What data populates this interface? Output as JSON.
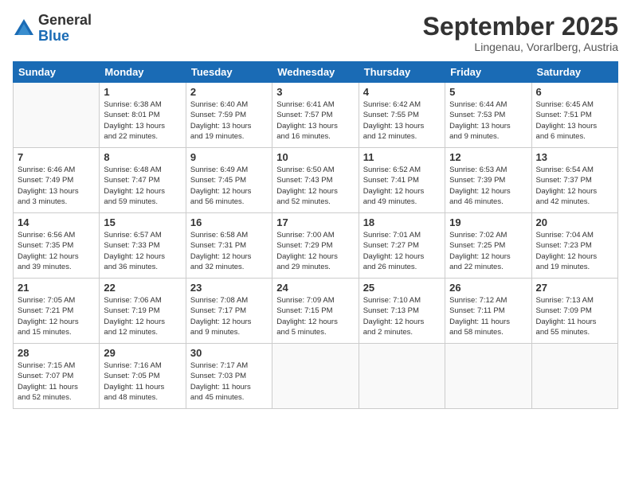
{
  "logo": {
    "general": "General",
    "blue": "Blue"
  },
  "header": {
    "month": "September 2025",
    "location": "Lingenau, Vorarlberg, Austria"
  },
  "weekdays": [
    "Sunday",
    "Monday",
    "Tuesday",
    "Wednesday",
    "Thursday",
    "Friday",
    "Saturday"
  ],
  "weeks": [
    [
      {
        "day": "",
        "info": ""
      },
      {
        "day": "1",
        "info": "Sunrise: 6:38 AM\nSunset: 8:01 PM\nDaylight: 13 hours\nand 22 minutes."
      },
      {
        "day": "2",
        "info": "Sunrise: 6:40 AM\nSunset: 7:59 PM\nDaylight: 13 hours\nand 19 minutes."
      },
      {
        "day": "3",
        "info": "Sunrise: 6:41 AM\nSunset: 7:57 PM\nDaylight: 13 hours\nand 16 minutes."
      },
      {
        "day": "4",
        "info": "Sunrise: 6:42 AM\nSunset: 7:55 PM\nDaylight: 13 hours\nand 12 minutes."
      },
      {
        "day": "5",
        "info": "Sunrise: 6:44 AM\nSunset: 7:53 PM\nDaylight: 13 hours\nand 9 minutes."
      },
      {
        "day": "6",
        "info": "Sunrise: 6:45 AM\nSunset: 7:51 PM\nDaylight: 13 hours\nand 6 minutes."
      }
    ],
    [
      {
        "day": "7",
        "info": "Sunrise: 6:46 AM\nSunset: 7:49 PM\nDaylight: 13 hours\nand 3 minutes."
      },
      {
        "day": "8",
        "info": "Sunrise: 6:48 AM\nSunset: 7:47 PM\nDaylight: 12 hours\nand 59 minutes."
      },
      {
        "day": "9",
        "info": "Sunrise: 6:49 AM\nSunset: 7:45 PM\nDaylight: 12 hours\nand 56 minutes."
      },
      {
        "day": "10",
        "info": "Sunrise: 6:50 AM\nSunset: 7:43 PM\nDaylight: 12 hours\nand 52 minutes."
      },
      {
        "day": "11",
        "info": "Sunrise: 6:52 AM\nSunset: 7:41 PM\nDaylight: 12 hours\nand 49 minutes."
      },
      {
        "day": "12",
        "info": "Sunrise: 6:53 AM\nSunset: 7:39 PM\nDaylight: 12 hours\nand 46 minutes."
      },
      {
        "day": "13",
        "info": "Sunrise: 6:54 AM\nSunset: 7:37 PM\nDaylight: 12 hours\nand 42 minutes."
      }
    ],
    [
      {
        "day": "14",
        "info": "Sunrise: 6:56 AM\nSunset: 7:35 PM\nDaylight: 12 hours\nand 39 minutes."
      },
      {
        "day": "15",
        "info": "Sunrise: 6:57 AM\nSunset: 7:33 PM\nDaylight: 12 hours\nand 36 minutes."
      },
      {
        "day": "16",
        "info": "Sunrise: 6:58 AM\nSunset: 7:31 PM\nDaylight: 12 hours\nand 32 minutes."
      },
      {
        "day": "17",
        "info": "Sunrise: 7:00 AM\nSunset: 7:29 PM\nDaylight: 12 hours\nand 29 minutes."
      },
      {
        "day": "18",
        "info": "Sunrise: 7:01 AM\nSunset: 7:27 PM\nDaylight: 12 hours\nand 26 minutes."
      },
      {
        "day": "19",
        "info": "Sunrise: 7:02 AM\nSunset: 7:25 PM\nDaylight: 12 hours\nand 22 minutes."
      },
      {
        "day": "20",
        "info": "Sunrise: 7:04 AM\nSunset: 7:23 PM\nDaylight: 12 hours\nand 19 minutes."
      }
    ],
    [
      {
        "day": "21",
        "info": "Sunrise: 7:05 AM\nSunset: 7:21 PM\nDaylight: 12 hours\nand 15 minutes."
      },
      {
        "day": "22",
        "info": "Sunrise: 7:06 AM\nSunset: 7:19 PM\nDaylight: 12 hours\nand 12 minutes."
      },
      {
        "day": "23",
        "info": "Sunrise: 7:08 AM\nSunset: 7:17 PM\nDaylight: 12 hours\nand 9 minutes."
      },
      {
        "day": "24",
        "info": "Sunrise: 7:09 AM\nSunset: 7:15 PM\nDaylight: 12 hours\nand 5 minutes."
      },
      {
        "day": "25",
        "info": "Sunrise: 7:10 AM\nSunset: 7:13 PM\nDaylight: 12 hours\nand 2 minutes."
      },
      {
        "day": "26",
        "info": "Sunrise: 7:12 AM\nSunset: 7:11 PM\nDaylight: 11 hours\nand 58 minutes."
      },
      {
        "day": "27",
        "info": "Sunrise: 7:13 AM\nSunset: 7:09 PM\nDaylight: 11 hours\nand 55 minutes."
      }
    ],
    [
      {
        "day": "28",
        "info": "Sunrise: 7:15 AM\nSunset: 7:07 PM\nDaylight: 11 hours\nand 52 minutes."
      },
      {
        "day": "29",
        "info": "Sunrise: 7:16 AM\nSunset: 7:05 PM\nDaylight: 11 hours\nand 48 minutes."
      },
      {
        "day": "30",
        "info": "Sunrise: 7:17 AM\nSunset: 7:03 PM\nDaylight: 11 hours\nand 45 minutes."
      },
      {
        "day": "",
        "info": ""
      },
      {
        "day": "",
        "info": ""
      },
      {
        "day": "",
        "info": ""
      },
      {
        "day": "",
        "info": ""
      }
    ]
  ]
}
